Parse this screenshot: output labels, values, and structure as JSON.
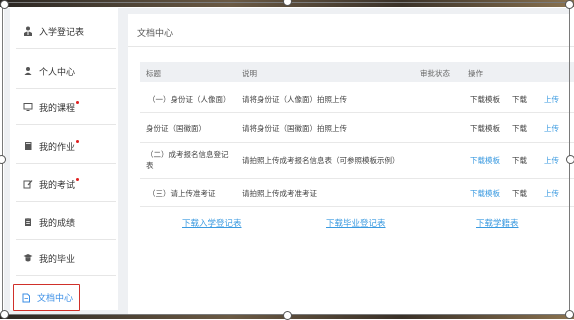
{
  "sidebar": {
    "items": [
      {
        "label": "入学登记表",
        "icon": "user-tie-icon",
        "badge": false
      },
      {
        "label": "个人中心",
        "icon": "user-icon",
        "badge": false
      },
      {
        "label": "我的课程",
        "icon": "monitor-icon",
        "badge": true
      },
      {
        "label": "我的作业",
        "icon": "book-icon",
        "badge": true
      },
      {
        "label": "我的考试",
        "icon": "edit-icon",
        "badge": true
      },
      {
        "label": "我的成绩",
        "icon": "clipboard-icon",
        "badge": false
      },
      {
        "label": "我的毕业",
        "icon": "graduation-icon",
        "badge": false
      },
      {
        "label": "文档中心",
        "icon": "document-icon",
        "badge": false,
        "active": true
      }
    ]
  },
  "main": {
    "title": "文档中心",
    "table": {
      "headers": [
        "标题",
        "说明",
        "审批状态",
        "操作"
      ],
      "rows": [
        {
          "title": "（一）身份证（人像面）",
          "desc": "请将身份证（人像面）拍照上传",
          "status": "",
          "template": "下载模板",
          "download": "下载",
          "upload": "上传",
          "template_link": false
        },
        {
          "title": "身份证（国徽面）",
          "desc": "请将身份证（国徽面）拍照上传",
          "status": "",
          "template": "下载模板",
          "download": "下载",
          "upload": "上传",
          "template_link": false
        },
        {
          "title": "（二）成考报名信息登记表",
          "desc": "请拍照上传成考报名信息表（可参照模板示例）",
          "status": "",
          "template": "下载模板",
          "download": "下载",
          "upload": "上传",
          "template_link": true
        },
        {
          "title": "（三）请上传准考证",
          "desc": "请拍照上传成考准考证",
          "status": "",
          "template": "下载模板",
          "download": "下载",
          "upload": "上传",
          "template_link": true
        }
      ]
    },
    "footer_links": [
      "下载入学登记表",
      "下载毕业登记表",
      "下载学籍表"
    ]
  },
  "colors": {
    "accent": "#3a9ae0",
    "active_border": "#d0302a",
    "badge": "#e02020"
  }
}
